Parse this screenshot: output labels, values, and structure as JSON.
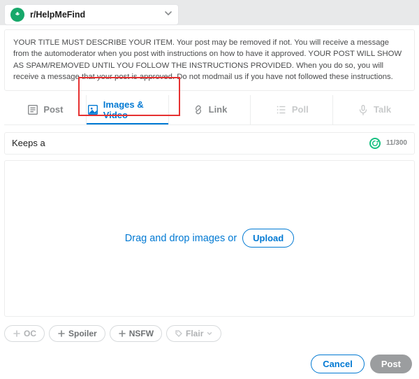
{
  "community": {
    "name": "r/HelpMeFind"
  },
  "rules_text": "YOUR TITLE MUST DESCRIBE YOUR ITEM. Your post may be removed if not. You will receive a message from the automoderator when you post with instructions on how to have it approved. YOUR POST WILL SHOW AS SPAM/REMOVED UNTIL YOU FOLLOW THE INSTRUCTIONS PROVIDED. When you do so, you will receive a message that your post is approved. Do not modmail us if you have not followed these instructions.",
  "tabs": {
    "post": "Post",
    "images": "Images & Video",
    "link": "Link",
    "poll": "Poll",
    "talk": "Talk"
  },
  "title": {
    "value": "Keeps a",
    "counter": "11/300"
  },
  "dropzone": {
    "text": "Drag and drop images or",
    "upload": "Upload"
  },
  "pills": {
    "oc": "OC",
    "spoiler": "Spoiler",
    "nsfw": "NSFW",
    "flair": "Flair"
  },
  "actions": {
    "cancel": "Cancel",
    "post": "Post"
  }
}
